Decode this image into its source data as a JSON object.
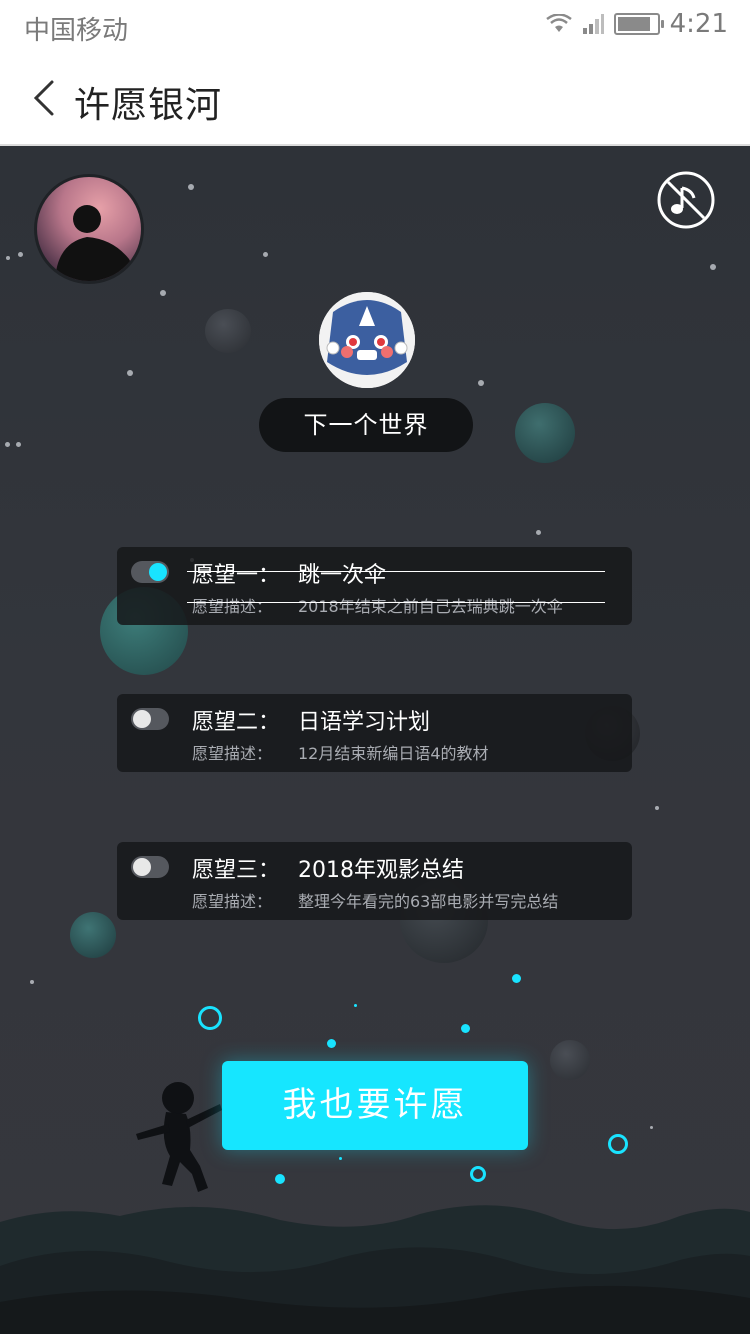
{
  "status_bar": {
    "carrier": "中国移动",
    "time": "4:21",
    "battery_level": 0.85,
    "icons": [
      "wifi-icon",
      "signal-icon",
      "battery-icon"
    ]
  },
  "nav": {
    "title": "许愿银河",
    "back_icon": "chevron-left-icon"
  },
  "scene": {
    "music_icon": "music-off-icon",
    "world_name": "下一个世界",
    "accent_color": "#16e6ff",
    "wishes": [
      {
        "title_label": "愿望一：",
        "title": "跳一次伞",
        "desc_label": "愿望描述：",
        "desc": "2018年结束之前自己去瑞典跳一次伞",
        "enabled": true,
        "completed": true
      },
      {
        "title_label": "愿望二：",
        "title": "日语学习计划",
        "desc_label": "愿望描述：",
        "desc": "12月结束新编日语4的教材",
        "enabled": false,
        "completed": false
      },
      {
        "title_label": "愿望三：",
        "title": "2018年观影总结",
        "desc_label": "愿望描述：",
        "desc": "整理今年看完的63部电影并写完总结",
        "enabled": false,
        "completed": false
      }
    ],
    "wish_button_label": "我也要许愿"
  }
}
